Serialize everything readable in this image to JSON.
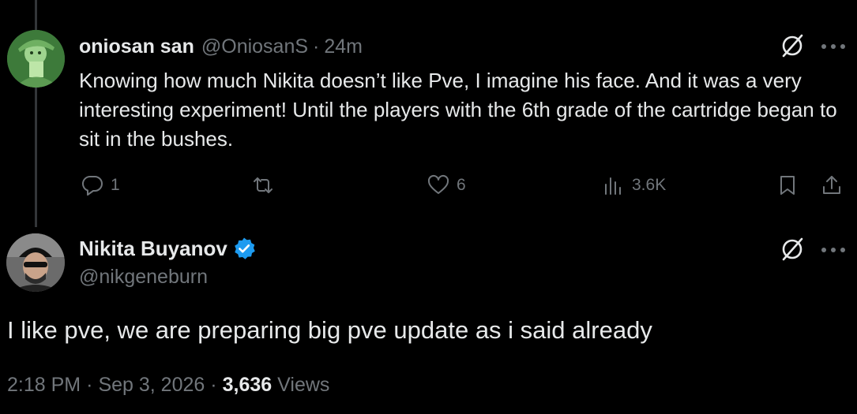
{
  "tweet1": {
    "display_name": "oniosan san",
    "handle": "@OniosanS",
    "separator": "·",
    "time": "24m",
    "text": "Knowing how much Nikita doesn’t like Pve, I imagine his face. And it was a very interesting experiment! Until the players with the 6th grade of the cartridge began to sit in the bushes.",
    "actions": {
      "reply_count": "1",
      "retweet_count": "",
      "like_count": "6",
      "views_count": "3.6K"
    }
  },
  "tweet2": {
    "display_name": "Nikita Buyanov",
    "handle": "@nikgeneburn",
    "text": "I like pve, we are preparing big pve update as i said already",
    "time": "2:18 PM",
    "separator": "·",
    "date": "Sep 3, 2026",
    "views_count": "3,636",
    "views_label": "Views"
  },
  "colors": {
    "background": "#000000",
    "primary_text": "#e7e9ea",
    "secondary_text": "#71767b",
    "verified_blue": "#1d9bf0",
    "thread_line": "#333639"
  },
  "icons": {
    "reply": "reply-icon",
    "retweet": "retweet-icon",
    "like": "heart-icon",
    "views": "views-icon",
    "bookmark": "bookmark-icon",
    "share": "share-icon",
    "grok": "grok-icon",
    "more": "more-icon",
    "verified": "verified-badge-icon"
  }
}
